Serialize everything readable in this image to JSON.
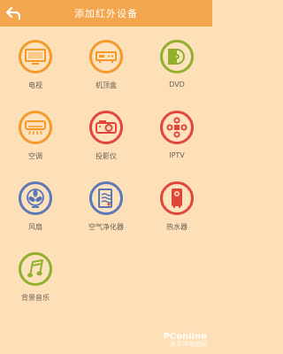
{
  "header": {
    "title": "添加红外设备",
    "back_icon": "back-arrow-icon"
  },
  "devices": [
    {
      "label": "电视",
      "icon": "tv-icon",
      "color": "#f39a2a"
    },
    {
      "label": "机顶盒",
      "icon": "set-top-box-icon",
      "color": "#f39a2a"
    },
    {
      "label": "DVD",
      "icon": "dvd-icon",
      "color": "#8fb02c"
    },
    {
      "label": "空调",
      "icon": "air-conditioner-icon",
      "color": "#f39a2a"
    },
    {
      "label": "投影仪",
      "icon": "projector-icon",
      "color": "#e0463a"
    },
    {
      "label": "IPTV",
      "icon": "iptv-icon",
      "color": "#e0463a"
    },
    {
      "label": "风扇",
      "icon": "fan-icon",
      "color": "#5a78b5"
    },
    {
      "label": "空气净化器",
      "icon": "air-purifier-icon",
      "color": "#5a78b5"
    },
    {
      "label": "热水器",
      "icon": "water-heater-icon",
      "color": "#e0463a"
    },
    {
      "label": "背景音乐",
      "icon": "music-icon",
      "color": "#8fb02c"
    }
  ],
  "watermark": {
    "main": "PConline",
    "sub": "太平洋电脑网"
  }
}
